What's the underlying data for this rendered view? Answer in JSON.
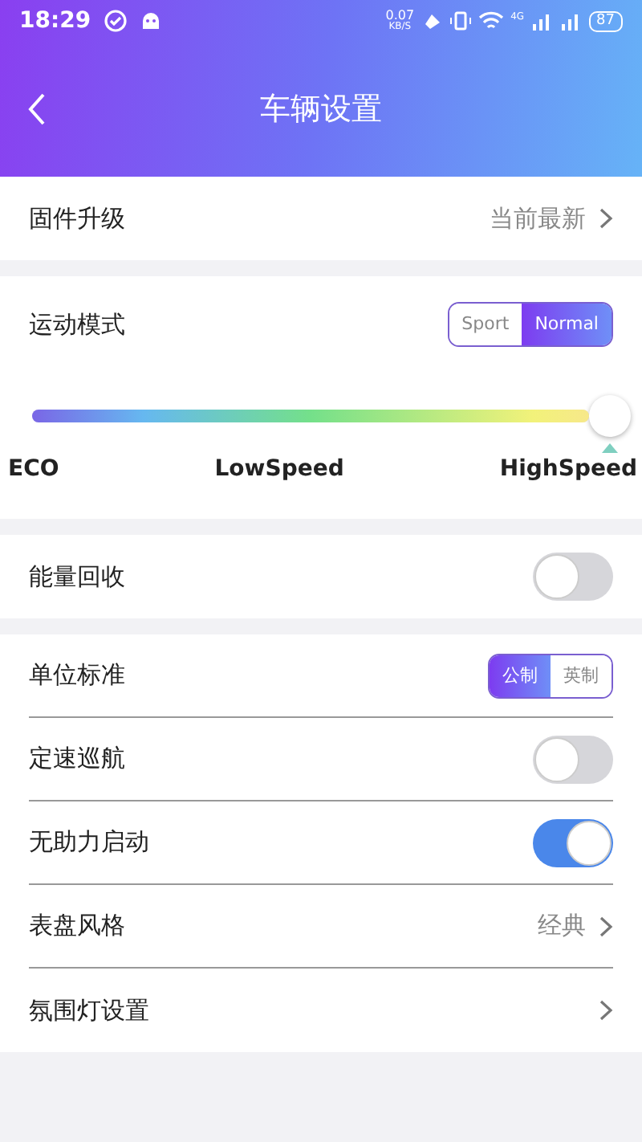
{
  "status_bar": {
    "time": "18:29",
    "net_speed": "0.07",
    "net_unit": "KB/S",
    "network": "4G",
    "battery": "87"
  },
  "header": {
    "title": "车辆设置"
  },
  "groups": [
    {
      "rows": [
        {
          "kind": "link",
          "label": "固件升级",
          "value": "当前最新"
        }
      ]
    },
    {
      "rows": [
        {
          "kind": "segmented",
          "label": "运动模式",
          "options": [
            {
              "label": "Sport",
              "selected": false
            },
            {
              "label": "Normal",
              "selected": true
            }
          ]
        },
        {
          "kind": "slider",
          "level": 1.0,
          "marks": [
            "ECO",
            "LowSpeed",
            "HighSpeed"
          ]
        }
      ]
    },
    {
      "rows": [
        {
          "kind": "toggle",
          "label": "能量回收",
          "on": false
        }
      ]
    },
    {
      "rows": [
        {
          "kind": "segmented",
          "label": "单位标准",
          "options": [
            {
              "label": "公制",
              "selected": true
            },
            {
              "label": "英制",
              "selected": false
            }
          ]
        },
        {
          "kind": "toggle",
          "label": "定速巡航",
          "on": false
        },
        {
          "kind": "toggle",
          "label": "无助力启动",
          "on": true
        },
        {
          "kind": "link",
          "label": "表盘风格",
          "value": "经典"
        },
        {
          "kind": "link",
          "label": "氛围灯设置"
        }
      ]
    }
  ]
}
